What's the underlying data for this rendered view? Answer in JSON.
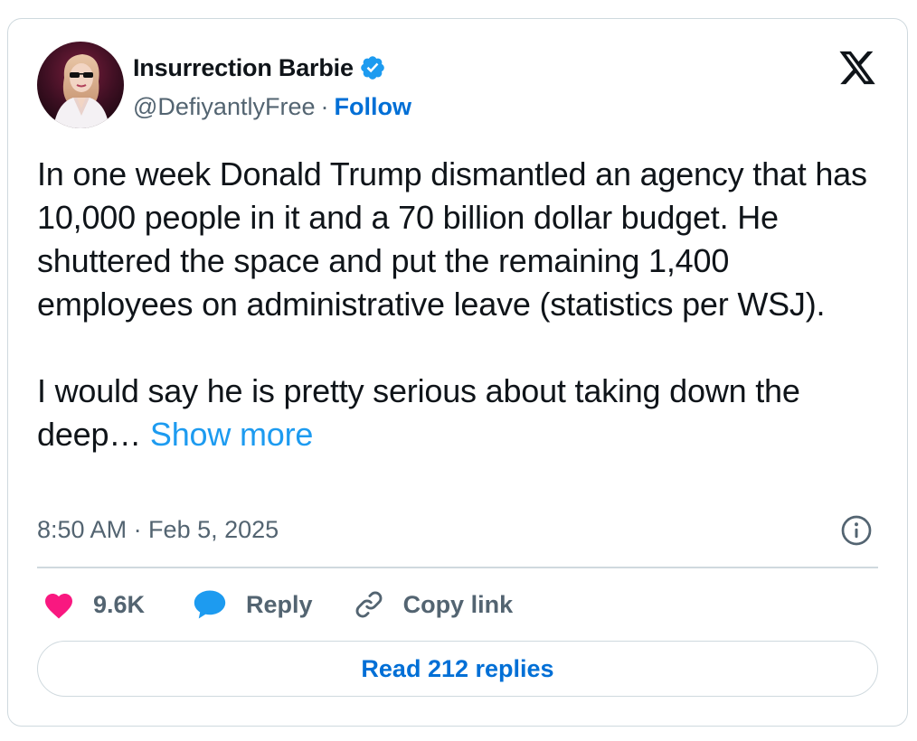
{
  "author": {
    "display_name": "Insurrection Barbie",
    "handle": "@DefiyantlyFree",
    "separator": "·",
    "follow_label": "Follow",
    "verified": true,
    "avatar_icon": "profile-photo-avatar"
  },
  "platform": {
    "logo_icon": "x-logo-icon"
  },
  "tweet": {
    "paragraph_1": "In one week Donald Trump dismantled an agency that has 10,000 people in it and a 70 billion dollar budget. He shuttered the space and put the remaining 1,400 employees on administrative leave (statistics per WSJ).",
    "paragraph_2": "I would say he is pretty serious about taking down the deep…",
    "show_more_label": "Show more",
    "timestamp": "8:50 AM · Feb 5, 2025"
  },
  "actions": {
    "like_count": "9.6K",
    "reply_label": "Reply",
    "copy_link_label": "Copy link"
  },
  "read_replies_label": "Read 212 replies",
  "colors": {
    "like": "#f91880",
    "reply": "#1d9bf0",
    "link": "#006fd6",
    "verified": "#1d9bf0",
    "muted_text": "#536471",
    "border": "#cfd9de"
  }
}
